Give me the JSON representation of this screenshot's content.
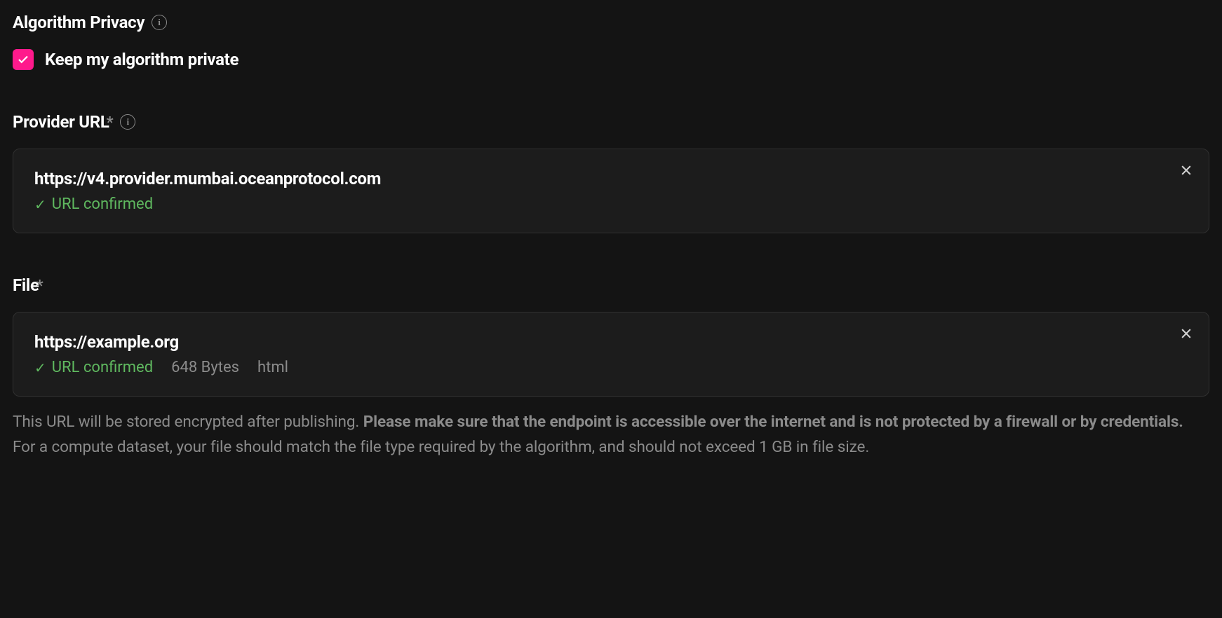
{
  "privacy_section": {
    "title": "Algorithm Privacy",
    "checkbox_label": "Keep my algorithm private",
    "checked": true
  },
  "provider_section": {
    "title": "Provider URL",
    "url": "https://v4.provider.mumbai.oceanprotocol.com",
    "confirmed_text": "URL confirmed"
  },
  "file_section": {
    "title": "File",
    "url": "https://example.org",
    "confirmed_text": "URL confirmed",
    "size": "648 Bytes",
    "file_type": "html",
    "help_prefix": "This URL will be stored encrypted after publishing. ",
    "help_bold": "Please make sure that the endpoint is accessible over the internet and is not protected by a firewall or by credentials.",
    "help_suffix": " For a compute dataset, your file should match the file type required by the algorithm, and should not exceed 1 GB in file size."
  }
}
